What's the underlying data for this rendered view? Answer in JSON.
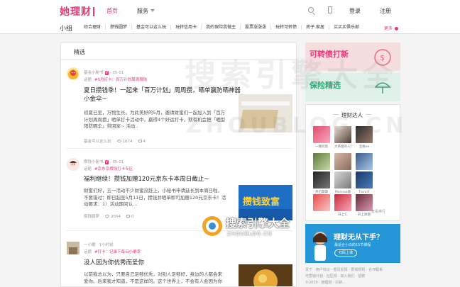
{
  "header": {
    "logo": "她理财",
    "nav_home": "首页",
    "nav_service": "服务",
    "login": "登录",
    "register": "注册"
  },
  "subnav": {
    "title": "小组",
    "items": [
      "综合理财",
      "攒钱圆梦",
      "基金可以这么玩",
      "玩转信用卡",
      "我的保险我做主",
      "股票涨涨涨",
      "玩转可转债",
      "房子.家居",
      "买买买俱乐部"
    ],
    "more": "更多"
  },
  "main": {
    "tab": "精选",
    "posts": [
      {
        "author": "基金小秘书",
        "badge": "V",
        "date": "05-01",
        "prefix": "话题",
        "tag": "#5月打卡：百万计划周周攒钱",
        "title_lines": [
          "夏日攒钱季！一起来「百万计划」周周攒，晒单赢防晒神器",
          "小金伞~"
        ],
        "summary_lines": [
          "初夏已至，万物生长。为此美好的5月，邀请财蜜们一起加入到「百万",
          "计划周周攒」晒单打卡活动中。赢得4个好运打卡，就有机会把「晒型",
          "阳防晒伞」带回家~ 活动.."
        ],
        "foot_prefix": "基金可以这么玩",
        "views": "1674",
        "comments": "4"
      },
      {
        "author": "攒钱小秘书",
        "badge": "V",
        "date": "05-01",
        "prefix": "话题",
        "tag": "#京东京攒钱打卡专区",
        "title_lines": [
          "福利继续！攒钱加赠120元京东卡本周日截止~"
        ],
        "summary_lines": [
          "财蜜们好，五一活动不少财蜜没赶上，小秘书申请延长到本周日啦，",
          "不要错过：即日起至5月11日，攒钱并晒单即可加赠120元京东卡！活",
          "动要求：1）活动期间认..."
        ],
        "foot_prefix": "攒钱圆梦",
        "views": "2654",
        "comments": "0"
      },
      {
        "author": "一小暖",
        "badge": "",
        "date": "1小时前",
        "prefix": "话题",
        "tag": "#打卡：记录下每日小确幸",
        "title_lines": [
          "没人因为你优秀而爱你"
        ],
        "summary_lines": [
          "以前我总以为，只要自己足够优秀，对别人足够好，身边的人都会来",
          "爱你。后来我才知道，不是这样的。这个世界上，不会有人会因为你"
        ],
        "foot_prefix": "",
        "views": "",
        "comments": ""
      }
    ],
    "ad_text": "攒钱致富"
  },
  "right": {
    "banner1": "可转债打新",
    "banner2": "保险精选",
    "talents_title": "理财达人",
    "talents": [
      "一颗阿莫",
      "大茶姐的人达",
      "宝格ee",
      "",
      "",
      "",
      "开启飘飘",
      "Monnaa刚",
      "Tiara大",
      "",
      "开上仁",
      "开上财都"
    ],
    "talents_more": "查看排行",
    "promo_title": "理财无从下手？",
    "promo_sub": "最适合小白的15节课程",
    "promo_btn": "扫码上课",
    "footer_lines": [
      "关于 · 用户协议 · 意见反馈 · 攒钱规则 · 合作联系",
      "可攒钱计划 · 社区规 · 加入我们 · 招聘",
      "©2019 · 她理财 · 打新..."
    ]
  },
  "watermark": {
    "line1": "搜索引擎大全",
    "line2": "ZHOUBLOG.CN",
    "logo_text": "搜索引擎大全",
    "logo_sub": "ZHOUBLOG.CN"
  },
  "colors": {
    "accent": "#e5397a",
    "promo_blue": "#2596d8"
  }
}
